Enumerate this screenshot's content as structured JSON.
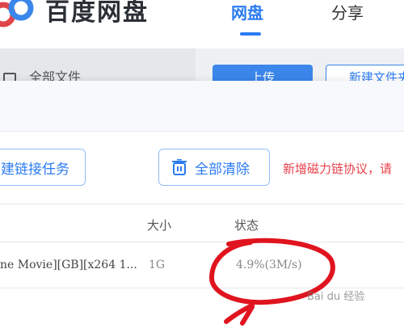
{
  "header": {
    "brand": "百度网盘",
    "tabs": [
      {
        "label": "网盘",
        "active": true
      },
      {
        "label": "分享",
        "active": false
      }
    ]
  },
  "sidebar": {
    "all_files_label": "全部文件"
  },
  "toolbar": {
    "upload_label": "上传",
    "new_folder_label": "新建文件夹"
  },
  "dialog": {
    "new_link_task_label": "建链接任务",
    "clear_all_label": "全部清除",
    "notice": "新增磁力链协议，请",
    "columns": {
      "size": "大小",
      "status": "状态"
    },
    "rows": [
      {
        "name": "ne Movie][GB][x264 1...",
        "size": "1G",
        "status": "4.9%(3M/s)",
        "progress_percent": 4.9,
        "speed": "3M/s"
      }
    ]
  },
  "annotation": {
    "color": "#e0141e"
  },
  "watermark": {
    "text": "Bai du 经验"
  },
  "colors": {
    "accent": "#2b7bf2",
    "notice": "#e8414b"
  }
}
